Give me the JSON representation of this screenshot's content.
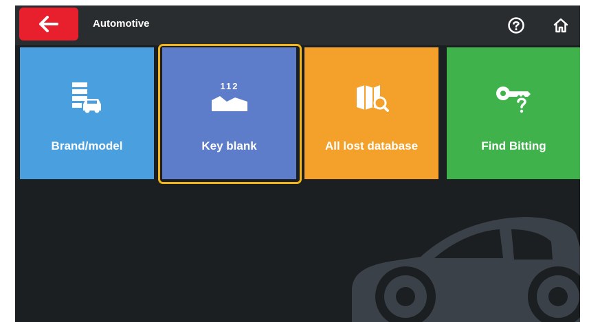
{
  "header": {
    "title": "Automotive",
    "back_icon": "arrow-left-icon",
    "help_icon": "help-circle-icon",
    "home_icon": "home-icon"
  },
  "tiles": [
    {
      "label": "Brand/model",
      "icon": "brand-model-icon",
      "color": "#4a9fdf"
    },
    {
      "label": "Key blank",
      "icon": "key-blank-icon",
      "color": "#5d7cc9",
      "selected": true
    },
    {
      "label": "All lost database",
      "icon": "database-search-icon",
      "color": "#f3a12b"
    },
    {
      "label": "Find Bitting",
      "icon": "key-question-icon",
      "color": "#3fb24b"
    }
  ],
  "key_blank_number": "112",
  "colors": {
    "back_button": "#e8202e",
    "highlight": "#f0b518",
    "background": "#1b1f21",
    "topbar": "#2a2d30"
  },
  "background_image": "car-silhouette"
}
